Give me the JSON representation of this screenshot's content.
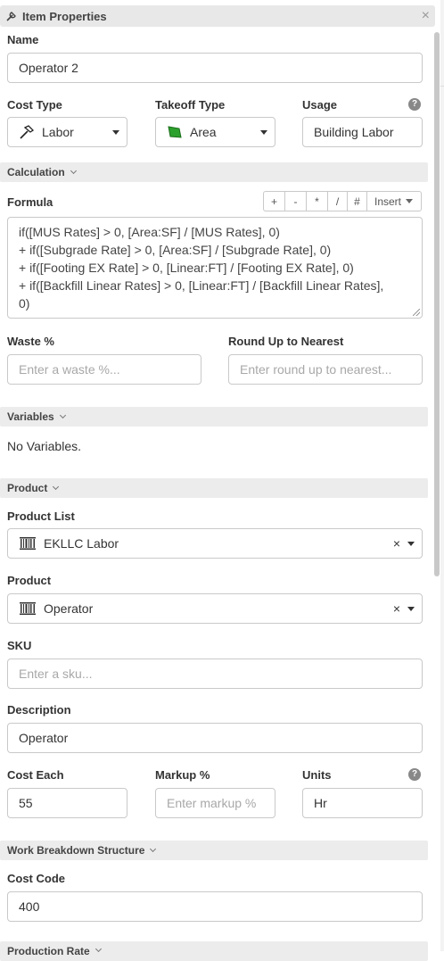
{
  "title": "Item Properties",
  "name": {
    "label": "Name",
    "value": "Operator 2"
  },
  "cost_type": {
    "label": "Cost Type",
    "value": "Labor",
    "icon": "hammer-icon"
  },
  "takeoff_type": {
    "label": "Takeoff Type",
    "value": "Area",
    "icon": "area-polygon-icon",
    "icon_color": "#2ca02c"
  },
  "usage": {
    "label": "Usage",
    "value": "Building Labor"
  },
  "calculation": {
    "section": "Calculation",
    "formula_label": "Formula",
    "buttons": [
      "+",
      "-",
      "*",
      "/",
      "#",
      "Insert"
    ],
    "formula_lines": [
      "if([MUS Rates] > 0, [Area:SF] / [MUS Rates], 0)",
      "+ if([Subgrade Rate] > 0, [Area:SF] / [Subgrade Rate], 0)",
      "+ if([Footing EX Rate] > 0, [Linear:FT] / [Footing EX Rate], 0)",
      "+ if([Backfill Linear Rates] > 0, [Linear:FT] / [Backfill Linear Rates],",
      "0)"
    ],
    "waste_label": "Waste %",
    "waste_placeholder": "Enter a waste %...",
    "round_label": "Round Up to Nearest",
    "round_placeholder": "Enter round up to nearest..."
  },
  "variables": {
    "section": "Variables",
    "empty_text": "No Variables."
  },
  "product": {
    "section": "Product",
    "list_label": "Product List",
    "list_value": "EKLLC Labor",
    "product_label": "Product",
    "product_value": "Operator",
    "sku_label": "SKU",
    "sku_placeholder": "Enter a sku...",
    "description_label": "Description",
    "description_value": "Operator",
    "cost_each_label": "Cost Each",
    "cost_each_value": "55",
    "markup_label": "Markup %",
    "markup_placeholder": "Enter markup %",
    "units_label": "Units",
    "units_value": "Hr"
  },
  "wbs": {
    "section": "Work Breakdown Structure",
    "cost_code_label": "Cost Code",
    "cost_code_value": "400"
  },
  "production_rate": {
    "section": "Production Rate"
  },
  "clear_symbol": "×",
  "help_symbol": "?",
  "close_symbol": "×"
}
